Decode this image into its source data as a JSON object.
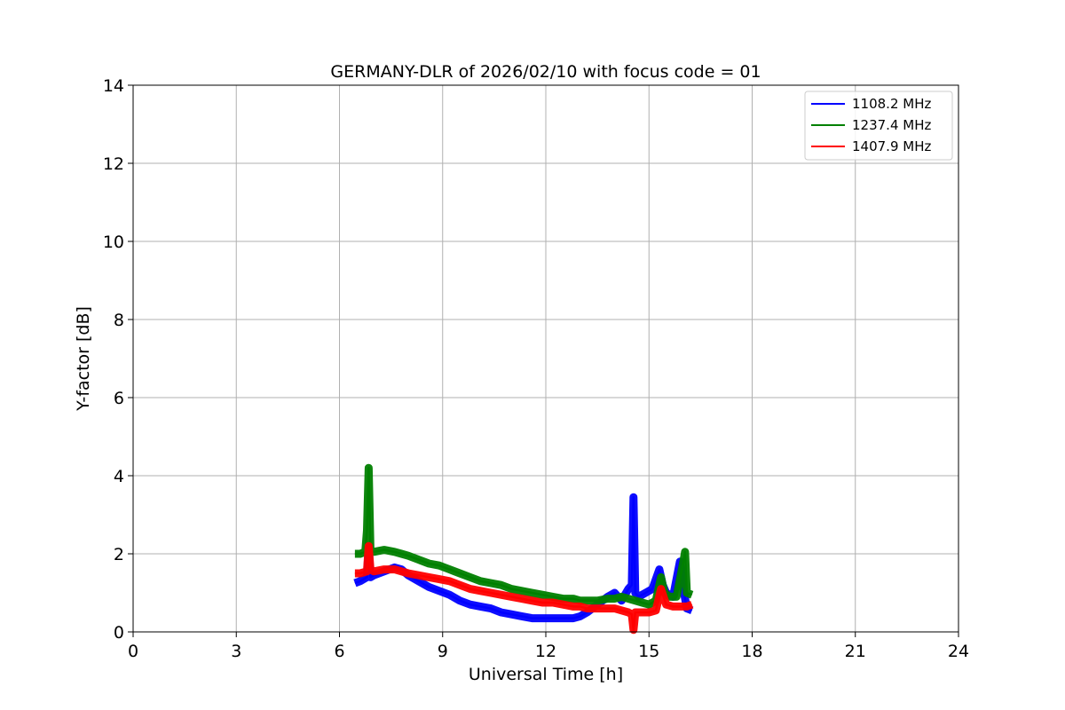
{
  "chart_data": {
    "type": "line",
    "title": "GERMANY-DLR of 2026/02/10 with focus code = 01",
    "xlabel": "Universal Time [h]",
    "ylabel": "Y-factor [dB]",
    "xlim": [
      0,
      24
    ],
    "ylim": [
      0,
      14
    ],
    "xticks": [
      0,
      3,
      6,
      9,
      12,
      15,
      18,
      21,
      24
    ],
    "yticks": [
      0,
      2,
      4,
      6,
      8,
      10,
      12,
      14
    ],
    "grid": true,
    "legend_position": "top-right",
    "series": [
      {
        "name": "1108.2 MHz",
        "color": "#0000ff",
        "x": [
          6.45,
          6.6,
          6.8,
          6.85,
          6.9,
          7.0,
          7.3,
          7.6,
          7.8,
          8.0,
          8.3,
          8.6,
          8.9,
          9.2,
          9.5,
          9.8,
          10.1,
          10.4,
          10.7,
          11.0,
          11.3,
          11.6,
          11.9,
          12.2,
          12.5,
          12.8,
          13.0,
          13.2,
          13.5,
          13.8,
          14.0,
          14.2,
          14.4,
          14.5,
          14.55,
          14.6,
          14.7,
          14.9,
          15.1,
          15.3,
          15.4,
          15.5,
          15.7,
          15.9,
          16.0,
          16.1,
          16.25
        ],
        "y": [
          1.25,
          1.3,
          1.4,
          2.2,
          1.4,
          1.45,
          1.55,
          1.65,
          1.6,
          1.45,
          1.3,
          1.15,
          1.05,
          0.95,
          0.8,
          0.7,
          0.65,
          0.6,
          0.5,
          0.45,
          0.4,
          0.35,
          0.35,
          0.35,
          0.35,
          0.35,
          0.4,
          0.5,
          0.7,
          0.9,
          1.0,
          0.8,
          1.1,
          1.2,
          3.45,
          1.0,
          0.9,
          1.0,
          1.1,
          1.6,
          1.2,
          1.0,
          0.9,
          1.8,
          1.1,
          0.6,
          0.55
        ]
      },
      {
        "name": "1237.4 MHz",
        "color": "#008000",
        "x": [
          6.45,
          6.6,
          6.75,
          6.8,
          6.85,
          6.9,
          7.0,
          7.3,
          7.6,
          7.8,
          8.0,
          8.3,
          8.6,
          8.9,
          9.2,
          9.5,
          9.8,
          10.1,
          10.4,
          10.7,
          11.0,
          11.3,
          11.6,
          11.9,
          12.2,
          12.5,
          12.8,
          13.0,
          13.2,
          13.5,
          13.8,
          14.0,
          14.2,
          14.4,
          14.6,
          14.8,
          15.0,
          15.2,
          15.35,
          15.45,
          15.6,
          15.8,
          16.0,
          16.05,
          16.1,
          16.25
        ],
        "y": [
          2.0,
          2.0,
          2.05,
          2.6,
          4.2,
          2.1,
          2.05,
          2.1,
          2.05,
          2.0,
          1.95,
          1.85,
          1.75,
          1.7,
          1.6,
          1.5,
          1.4,
          1.3,
          1.25,
          1.2,
          1.1,
          1.05,
          1.0,
          0.95,
          0.9,
          0.85,
          0.85,
          0.8,
          0.8,
          0.8,
          0.85,
          0.85,
          0.9,
          0.85,
          0.8,
          0.75,
          0.7,
          0.8,
          1.4,
          1.0,
          0.9,
          0.9,
          1.8,
          2.05,
          1.0,
          0.95
        ]
      },
      {
        "name": "1407.9 MHz",
        "color": "#ff0000",
        "x": [
          6.45,
          6.6,
          6.8,
          6.85,
          6.9,
          7.0,
          7.3,
          7.6,
          7.8,
          8.0,
          8.3,
          8.6,
          8.9,
          9.2,
          9.5,
          9.8,
          10.1,
          10.4,
          10.7,
          11.0,
          11.3,
          11.6,
          11.9,
          12.2,
          12.5,
          12.8,
          13.0,
          13.2,
          13.5,
          13.8,
          14.0,
          14.2,
          14.4,
          14.5,
          14.55,
          14.6,
          14.8,
          15.0,
          15.2,
          15.35,
          15.5,
          15.7,
          15.9,
          16.1,
          16.25
        ],
        "y": [
          1.5,
          1.5,
          1.55,
          2.2,
          1.6,
          1.55,
          1.6,
          1.6,
          1.55,
          1.5,
          1.45,
          1.4,
          1.35,
          1.3,
          1.2,
          1.1,
          1.05,
          1.0,
          0.95,
          0.9,
          0.85,
          0.8,
          0.75,
          0.75,
          0.7,
          0.65,
          0.65,
          0.6,
          0.6,
          0.6,
          0.6,
          0.55,
          0.5,
          0.45,
          0.05,
          0.5,
          0.5,
          0.5,
          0.55,
          1.1,
          0.7,
          0.65,
          0.65,
          0.65,
          0.7
        ]
      }
    ]
  }
}
